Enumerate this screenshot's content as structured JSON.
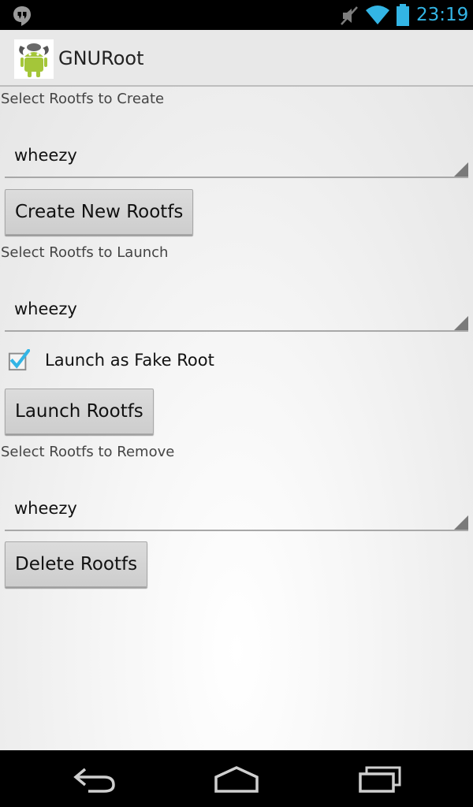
{
  "status_bar": {
    "time": "23:19",
    "icons": [
      "hangouts-icon",
      "mute-icon",
      "wifi-icon",
      "battery-icon"
    ],
    "accent_color": "#33b5e5"
  },
  "action_bar": {
    "title": "GNURoot",
    "icon": "gnuroot-app-icon"
  },
  "create_section": {
    "label": "Select Rootfs to Create",
    "selected": "wheezy",
    "button_label": "Create New Rootfs"
  },
  "launch_section": {
    "label": "Select Rootfs to Launch",
    "selected": "wheezy",
    "fake_root_label": "Launch as Fake Root",
    "fake_root_checked": true,
    "button_label": "Launch Rootfs"
  },
  "remove_section": {
    "label": "Select Rootfs to Remove",
    "selected": "wheezy",
    "button_label": "Delete Rootfs"
  },
  "nav_bar": {
    "buttons": [
      "back-icon",
      "home-icon",
      "recent-apps-icon"
    ]
  }
}
